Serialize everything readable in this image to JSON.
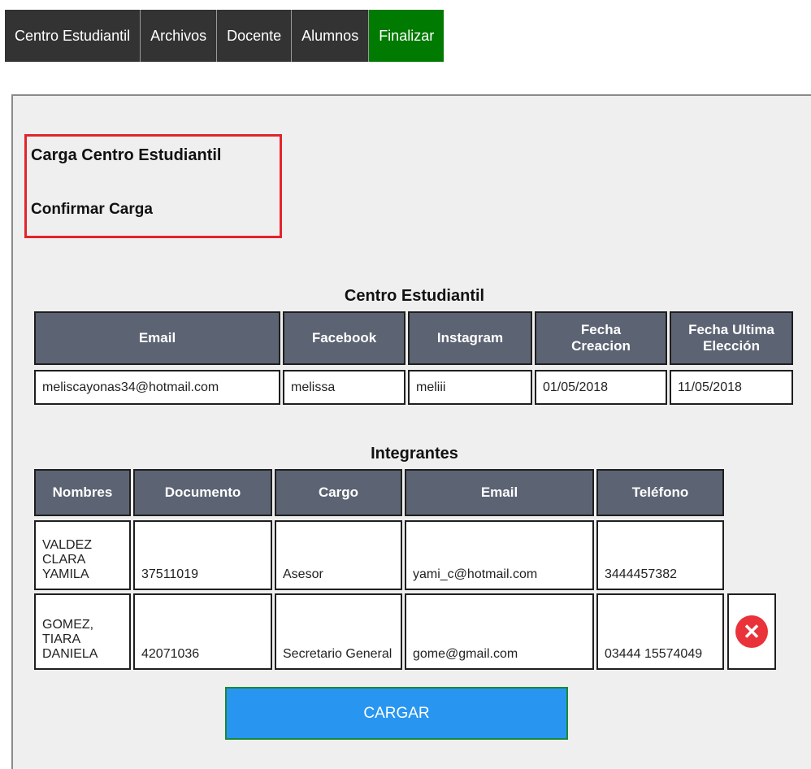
{
  "tabs": [
    {
      "label": "Centro Estudiantil"
    },
    {
      "label": "Archivos"
    },
    {
      "label": "Docente"
    },
    {
      "label": "Alumnos"
    },
    {
      "label": "Finalizar",
      "active": true
    }
  ],
  "panel": {
    "title": "Carga Centro Estudiantil",
    "subtitle": "Confirmar Carga"
  },
  "centro": {
    "title": "Centro Estudiantil",
    "headers": [
      "Email",
      "Facebook",
      "Instagram",
      "Fecha Creacion",
      "Fecha Ultima Elección"
    ],
    "row": [
      "meliscayonas34@hotmail.com",
      "melissa",
      "meliii",
      "01/05/2018",
      "11/05/2018"
    ]
  },
  "integrantes": {
    "title": "Integrantes",
    "headers": [
      "Nombres",
      "Documento",
      "Cargo",
      "Email",
      "Teléfono"
    ],
    "rows": [
      [
        "VALDEZ CLARA YAMILA",
        "37511019",
        "Asesor",
        "yami_c@hotmail.com",
        "3444457382"
      ],
      [
        "GOMEZ, TIARA DANIELA",
        "42071036",
        "Secretario General",
        "gome@gmail.com",
        "03444 15574049"
      ]
    ]
  },
  "actions": {
    "cargar_label": "CARGAR",
    "delete_icon": "close-circle-icon"
  },
  "colors": {
    "tab_bg": "#333333",
    "tab_active": "#007a00",
    "header_bg": "#5c6373",
    "cargar_bg": "#2896f0",
    "delete_red": "#e9323a",
    "highlight_border": "#e4232b"
  }
}
